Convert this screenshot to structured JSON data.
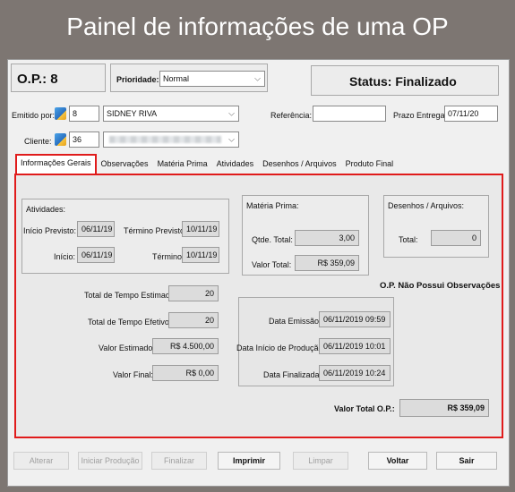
{
  "banner_title": "Painel de informações de uma OP",
  "header": {
    "op_label": "O.P.: 8",
    "priority_label": "Prioridade:",
    "priority_value": "Normal",
    "status_label": "Status: Finalizado"
  },
  "form": {
    "emitido_label": "Emitido por:",
    "emitido_code": "8",
    "emitido_name": "SIDNEY RIVA",
    "referencia_label": "Referência:",
    "referencia_value": "",
    "prazo_label": "Prazo Entrega:",
    "prazo_value": "07/11/20",
    "cliente_label": "Cliente:",
    "cliente_code": "36"
  },
  "tabs": [
    {
      "label": "Informações Gerais"
    },
    {
      "label": "Observações"
    },
    {
      "label": "Matéria Prima"
    },
    {
      "label": "Atividades"
    },
    {
      "label": "Desenhos / Arquivos"
    },
    {
      "label": "Produto Final"
    }
  ],
  "atividades": {
    "title": "Atividades:",
    "inicio_previsto_label": "Início Previsto:",
    "inicio_previsto_value": "06/11/19",
    "termino_previsto_label": "Término Previsto:",
    "termino_previsto_value": "10/11/19",
    "inicio_label": "Início:",
    "inicio_value": "06/11/19",
    "termino_label": "Término:",
    "termino_value": "10/11/19",
    "tempo_estimado_label": "Total de Tempo Estimado:",
    "tempo_estimado_value": "20",
    "tempo_efetivo_label": "Total de Tempo Efetivo:",
    "tempo_efetivo_value": "20",
    "valor_estimado_label": "Valor Estimado:",
    "valor_estimado_value": "R$ 4.500,00",
    "valor_final_label": "Valor Final:",
    "valor_final_value": "R$ 0,00"
  },
  "materia": {
    "title": "Matéria Prima:",
    "qtde_label": "Qtde. Total:",
    "qtde_value": "3,00",
    "valor_label": "Valor Total:",
    "valor_value": "R$ 359,09"
  },
  "desenhos": {
    "title": "Desenhos / Arquivos:",
    "total_label": "Total:",
    "total_value": "0"
  },
  "obs_text": "O.P. Não Possui Observações",
  "datas": {
    "emissao_label": "Data Emissão:",
    "emissao_value": "06/11/2019 09:59",
    "inicio_prod_label": "Data Início de Produção:",
    "inicio_prod_value": "06/11/2019 10:01",
    "finalizada_label": "Data Finalizada:",
    "finalizada_value": "06/11/2019 10:24"
  },
  "valor_total": {
    "label": "Valor Total O.P.:",
    "value": "R$ 359,09"
  },
  "buttons": {
    "alterar": "Alterar",
    "iniciar": "Iniciar Produção",
    "finalizar": "Finalizar",
    "imprimir": "Imprimir",
    "limpar": "Limpar",
    "voltar": "Voltar",
    "sair": "Sair"
  },
  "colors": {
    "highlight": "#e01b1b",
    "background": "#7d7672"
  }
}
